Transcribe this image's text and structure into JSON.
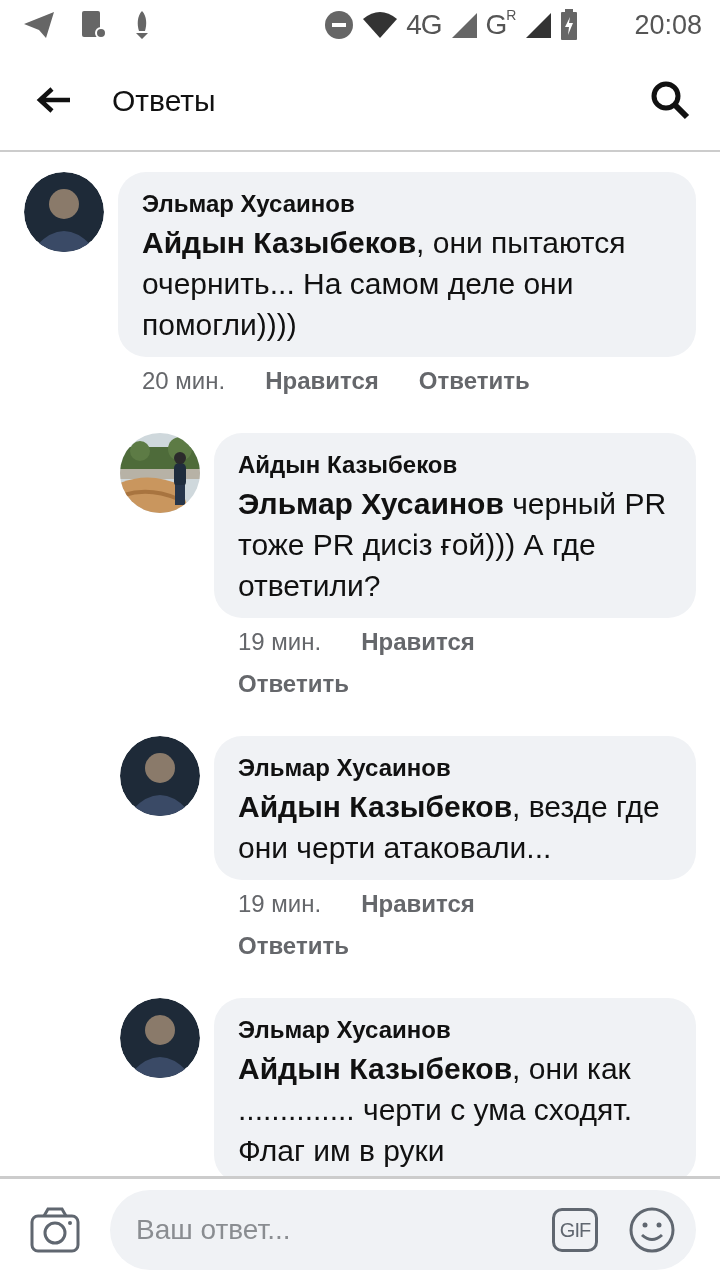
{
  "status_bar": {
    "time": "20:08",
    "network": "4G",
    "network_2": "G",
    "roaming": "R"
  },
  "header": {
    "title": "Ответы"
  },
  "comments": [
    {
      "author": "Эльмар Хусаинов",
      "kind": "silhouette",
      "text": "**Айдын Казыбеков**, они пытаются очернить... На самом деле они помогли))))",
      "time": "20 мин.",
      "like": "Нравится",
      "reply": "Ответить",
      "children": [
        {
          "author": "Айдын Казыбеков",
          "kind": "picture",
          "text": "**Эльмар Хусаинов** черный PR тоже PR дисіз ғой))) А где ответили?",
          "time": "19 мин.",
          "like": "Нравится",
          "reply": "Ответить"
        },
        {
          "author": "Эльмар Хусаинов",
          "kind": "silhouette",
          "text": "**Айдын Казыбеков**, везде где они черти атаковали...",
          "time": "19 мин.",
          "like": "Нравится",
          "reply": "Ответить"
        },
        {
          "author": "Эльмар Хусаинов",
          "kind": "silhouette",
          "text": "**Айдын Казыбеков**, они как .............. черти с ума сходят. Флаг им в руки"
        }
      ]
    }
  ],
  "composer": {
    "placeholder": "Ваш ответ...",
    "gif": "GIF"
  }
}
